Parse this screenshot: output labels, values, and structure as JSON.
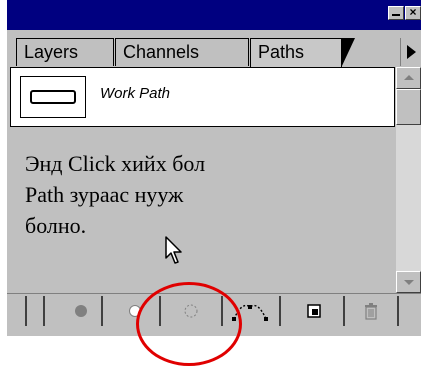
{
  "window": {
    "minimize_icon": "minimize-icon",
    "close_icon": "close-icon",
    "close_glyph": "×"
  },
  "tabs": [
    {
      "label": "Layers"
    },
    {
      "label": "Channels"
    },
    {
      "label": "Paths",
      "active": true
    }
  ],
  "path_list": {
    "items": [
      {
        "label": "Work Path",
        "thumb_icon": "path-thumbnail-icon"
      }
    ]
  },
  "instruction": {
    "lines": [
      "Энд Click хийх бол",
      "Path зураас нууж",
      "болно."
    ]
  },
  "bottom_toolbar": {
    "buttons": [
      {
        "name": "fill-path-button",
        "icon": "fill-path-icon"
      },
      {
        "name": "stroke-path-button",
        "icon": "stroke-path-icon"
      },
      {
        "name": "load-path-as-selection-button",
        "icon": "load-selection-icon"
      },
      {
        "name": "make-work-path-button",
        "icon": "make-work-path-icon"
      },
      {
        "name": "new-path-button",
        "icon": "new-path-icon"
      },
      {
        "name": "delete-path-button",
        "icon": "trash-icon"
      }
    ]
  },
  "colors": {
    "titlebar": "#000080",
    "panel": "#c0c0c0",
    "annotation": "#e00000"
  }
}
